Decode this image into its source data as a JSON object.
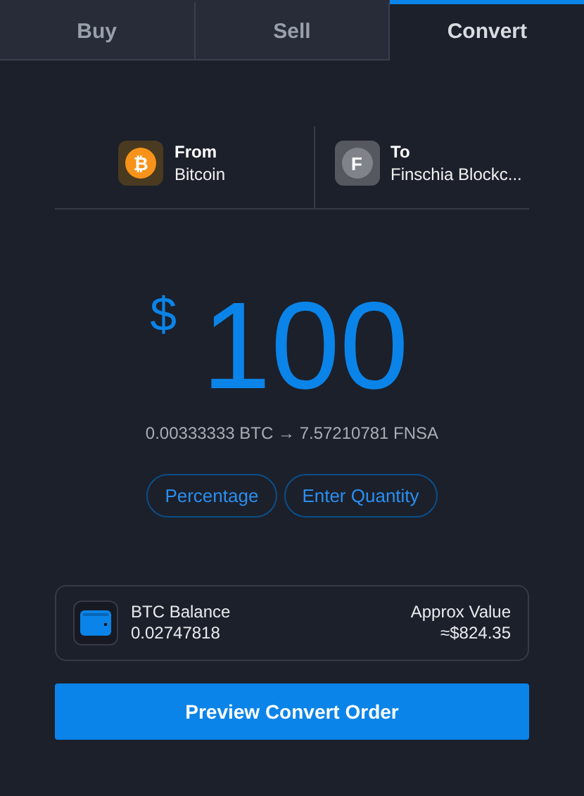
{
  "tabs": [
    {
      "label": "Buy",
      "selected": false
    },
    {
      "label": "Sell",
      "selected": false
    },
    {
      "label": "Convert",
      "selected": true
    }
  ],
  "pair": [
    {
      "label": "From",
      "asset": "Bitcoin",
      "icon_glyph": "₿",
      "kind": "bitcoin"
    },
    {
      "label": "To",
      "asset": "Finschia Blockc...",
      "icon_glyph": "F",
      "kind": "token"
    }
  ],
  "amount": {
    "currency": "$",
    "value": "100"
  },
  "conversion": "0.00333333 BTC → 7.57210781 FNSA",
  "modes": [
    "Percentage",
    "Enter Quantity"
  ],
  "balance": {
    "label": "BTC Balance",
    "value": "0.02747818",
    "approx_label": "Approx Value",
    "approx_value": "≈$824.35"
  },
  "submit": "Preview Convert Order"
}
